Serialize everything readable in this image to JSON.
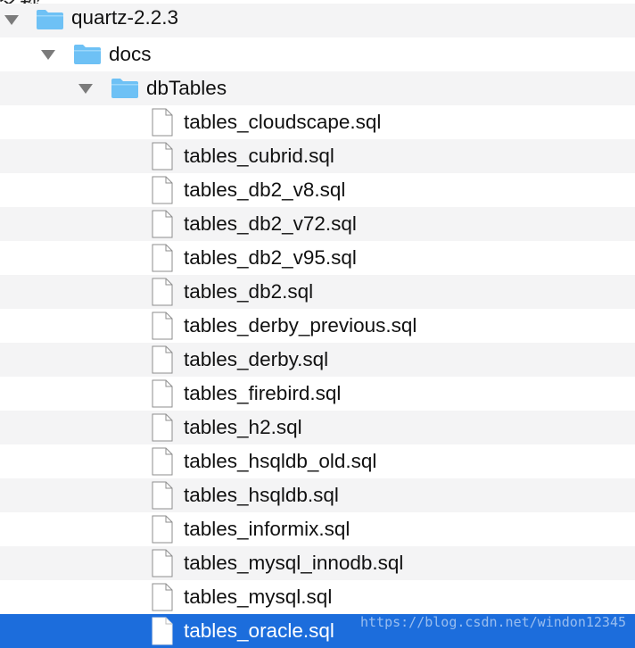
{
  "topbar": {
    "cut_text": "名称"
  },
  "tree": {
    "root": {
      "label": "quartz-2.2.3",
      "icon": "folder-icon",
      "expanded": true
    },
    "docs": {
      "label": "docs",
      "icon": "folder-icon",
      "expanded": true
    },
    "dbtables": {
      "label": "dbTables",
      "icon": "folder-icon",
      "expanded": true
    },
    "files": [
      {
        "label": "tables_cloudscape.sql"
      },
      {
        "label": "tables_cubrid.sql"
      },
      {
        "label": "tables_db2_v8.sql"
      },
      {
        "label": "tables_db2_v72.sql"
      },
      {
        "label": "tables_db2_v95.sql"
      },
      {
        "label": "tables_db2.sql"
      },
      {
        "label": "tables_derby_previous.sql"
      },
      {
        "label": "tables_derby.sql"
      },
      {
        "label": "tables_firebird.sql"
      },
      {
        "label": "tables_h2.sql"
      },
      {
        "label": "tables_hsqldb_old.sql"
      },
      {
        "label": "tables_hsqldb.sql"
      },
      {
        "label": "tables_informix.sql"
      },
      {
        "label": "tables_mysql_innodb.sql"
      },
      {
        "label": "tables_mysql.sql"
      },
      {
        "label": "tables_oracle.sql",
        "selected": true
      }
    ]
  },
  "watermark": "https://blog.csdn.net/windon12345",
  "colors": {
    "selection": "#1c6ddc",
    "alt_row": "#f4f4f5",
    "folder": "#6ec1f5",
    "disclosure": "#7b7b7b"
  }
}
